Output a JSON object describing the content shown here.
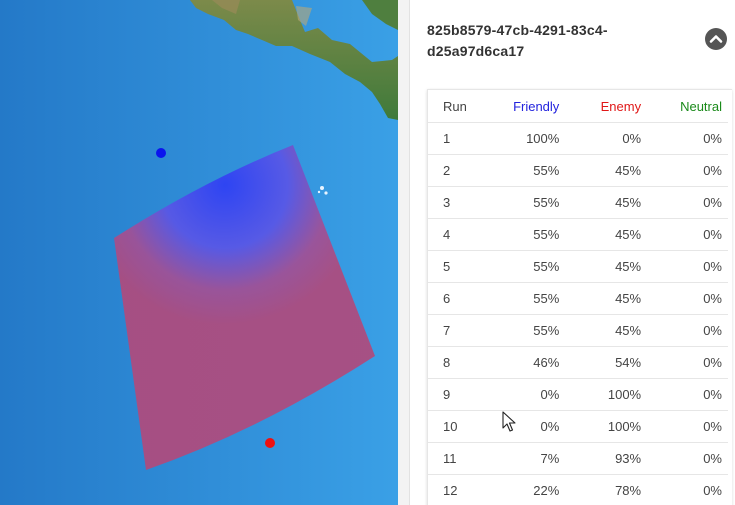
{
  "map": {
    "markers": [
      {
        "name": "friendly-marker",
        "color": "#0a14ee"
      },
      {
        "name": "enemy-marker",
        "color": "#ee1010"
      }
    ],
    "area_colors": {
      "friendly": "#3c50f0",
      "enemy": "#b04a7c"
    }
  },
  "panel": {
    "scenario_id": "825b8579-47cb-4291-83c4-d25a97d6ca17",
    "collapse_icon": "chevron-up-icon",
    "table": {
      "headers": {
        "run": "Run",
        "friendly": "Friendly",
        "enemy": "Enemy",
        "neutral": "Neutral"
      },
      "header_colors": {
        "friendly": "#2222dd",
        "enemy": "#e01818",
        "neutral": "#1a8a1a"
      },
      "rows": [
        {
          "run": "1",
          "friendly": "100%",
          "enemy": "0%",
          "neutral": "0%"
        },
        {
          "run": "2",
          "friendly": "55%",
          "enemy": "45%",
          "neutral": "0%"
        },
        {
          "run": "3",
          "friendly": "55%",
          "enemy": "45%",
          "neutral": "0%"
        },
        {
          "run": "4",
          "friendly": "55%",
          "enemy": "45%",
          "neutral": "0%"
        },
        {
          "run": "5",
          "friendly": "55%",
          "enemy": "45%",
          "neutral": "0%"
        },
        {
          "run": "6",
          "friendly": "55%",
          "enemy": "45%",
          "neutral": "0%"
        },
        {
          "run": "7",
          "friendly": "55%",
          "enemy": "45%",
          "neutral": "0%"
        },
        {
          "run": "8",
          "friendly": "46%",
          "enemy": "54%",
          "neutral": "0%"
        },
        {
          "run": "9",
          "friendly": "0%",
          "enemy": "100%",
          "neutral": "0%"
        },
        {
          "run": "10",
          "friendly": "0%",
          "enemy": "100%",
          "neutral": "0%"
        },
        {
          "run": "11",
          "friendly": "7%",
          "enemy": "93%",
          "neutral": "0%"
        },
        {
          "run": "12",
          "friendly": "22%",
          "enemy": "78%",
          "neutral": "0%"
        }
      ]
    }
  }
}
